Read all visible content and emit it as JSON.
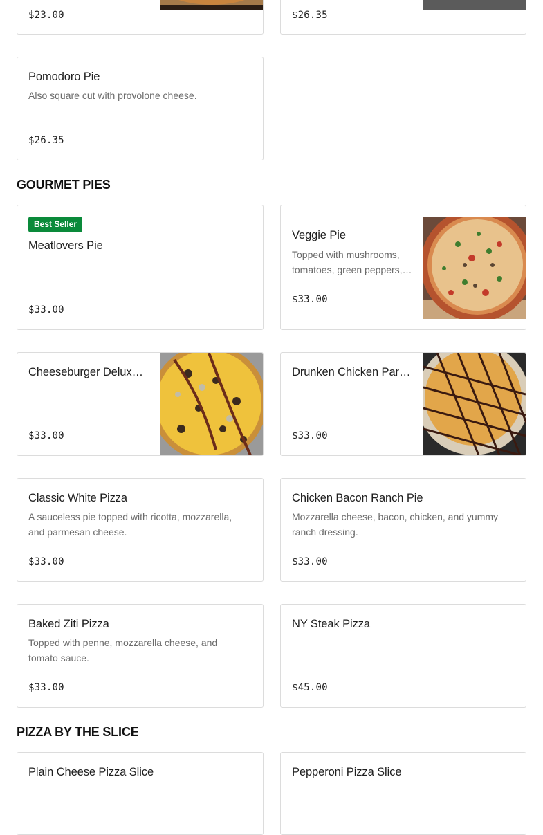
{
  "top_cards": [
    {
      "price": "$23.00"
    },
    {
      "price": "$26.35"
    }
  ],
  "pomodoro": {
    "title": "Pomodoro Pie",
    "desc": "Also square cut with provolone cheese.",
    "price": "$26.35"
  },
  "sections": {
    "gourmet": "GOURMET PIES",
    "slice": "PIZZA BY THE SLICE"
  },
  "gourmet_items": [
    {
      "badge": "Best Seller",
      "title": "Meatlovers Pie",
      "price": "$33.00"
    },
    {
      "title": "Veggie Pie",
      "desc": "Topped with mushrooms, tomatoes, green peppers, onions, and olives.",
      "price": "$33.00",
      "image": "veggie-pizza-photo"
    },
    {
      "title": "Cheeseburger Deluxe Pizza",
      "price": "$33.00",
      "image": "cheeseburger-pizza-photo"
    },
    {
      "title": "Drunken Chicken Parm Pizza",
      "price": "$33.00",
      "image": "chicken-pizza-photo"
    },
    {
      "title": "Classic White Pizza",
      "desc": "A sauceless pie topped with ricotta, mozzarella, and parmesan cheese.",
      "price": "$33.00"
    },
    {
      "title": "Chicken Bacon Ranch Pie",
      "desc": "Mozzarella cheese, bacon, chicken, and yummy ranch dressing.",
      "price": "$33.00"
    },
    {
      "title": "Baked Ziti Pizza",
      "desc": "Topped with penne, mozzarella cheese, and tomato sauce.",
      "price": "$33.00"
    },
    {
      "title": "NY Steak Pizza",
      "price": "$45.00"
    }
  ],
  "slice_items": [
    {
      "title": "Plain Cheese Pizza Slice"
    },
    {
      "title": "Pepperoni Pizza Slice"
    }
  ],
  "colors": {
    "badge": "#0a8a3a",
    "border": "#dcdcdc",
    "description": "#6b6b6b"
  }
}
